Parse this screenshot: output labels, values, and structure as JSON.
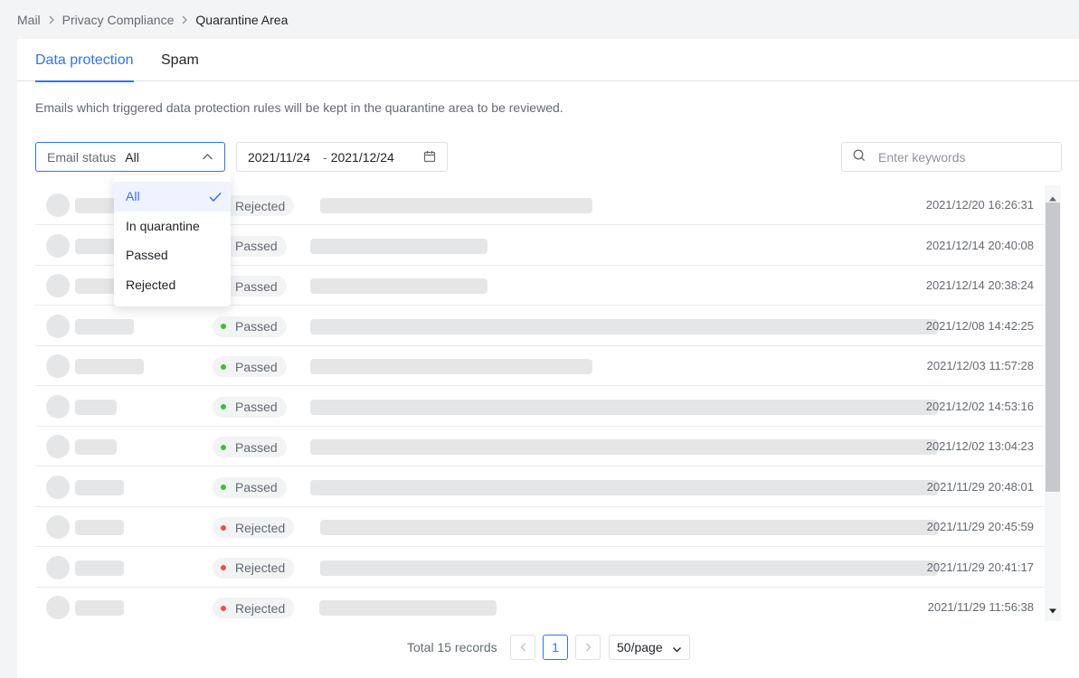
{
  "breadcrumb": {
    "items": [
      "Mail",
      "Privacy Compliance"
    ],
    "current": "Quarantine Area"
  },
  "tabs": [
    {
      "label": "Data protection",
      "active": true
    },
    {
      "label": "Spam",
      "active": false
    }
  ],
  "description": "Emails which triggered data protection rules will be kept in the quarantine area to be reviewed.",
  "filters": {
    "email_status": {
      "label": "Email status",
      "value": "All"
    },
    "date_range": {
      "start": "2021/11/24",
      "separator": "-",
      "end": "2021/12/24"
    },
    "search": {
      "placeholder": "Enter keywords"
    }
  },
  "dropdown": {
    "options": [
      {
        "label": "All",
        "selected": true
      },
      {
        "label": "In quarantine",
        "selected": false
      },
      {
        "label": "Passed",
        "selected": false
      },
      {
        "label": "Rejected",
        "selected": false
      }
    ]
  },
  "emails": [
    {
      "status": "Rejected",
      "time": "2021/12/20 16:26:31"
    },
    {
      "status": "Passed",
      "time": "2021/12/14 20:40:08"
    },
    {
      "status": "Passed",
      "time": "2021/12/14 20:38:24"
    },
    {
      "status": "Passed",
      "time": "2021/12/08 14:42:25"
    },
    {
      "status": "Passed",
      "time": "2021/12/03 11:57:28"
    },
    {
      "status": "Passed",
      "time": "2021/12/02 14:53:16"
    },
    {
      "status": "Passed",
      "time": "2021/12/02 13:04:23"
    },
    {
      "status": "Passed",
      "time": "2021/11/29 20:48:01"
    },
    {
      "status": "Rejected",
      "time": "2021/11/29 20:45:59"
    },
    {
      "status": "Rejected",
      "time": "2021/11/29 20:41:17"
    },
    {
      "status": "Rejected",
      "time": "2021/11/29 11:56:38"
    }
  ],
  "pagination": {
    "total": "Total 15 records",
    "current_page": "1",
    "page_size": "50/page"
  },
  "colors": {
    "accent": "#3370ff",
    "passed": "#34c724",
    "rejected": "#f54a45"
  }
}
